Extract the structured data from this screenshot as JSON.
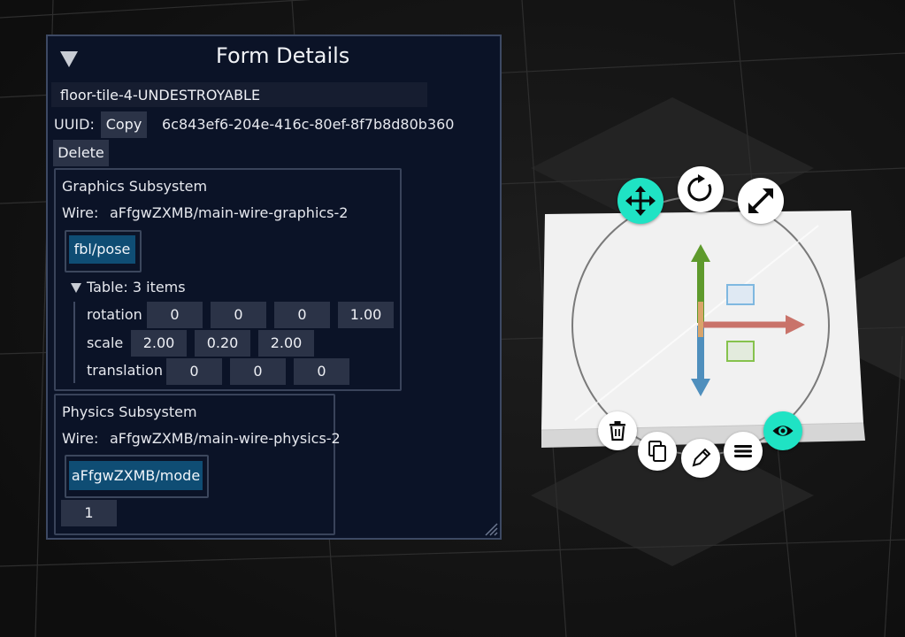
{
  "panel": {
    "title": "Form Details",
    "name_value": "floor-tile-4-UNDESTROYABLE",
    "uuid_label": "UUID:",
    "copy_label": "Copy",
    "uuid_value": "6c843ef6-204e-416c-80ef-8f7b8d80b360",
    "delete_label": "Delete"
  },
  "graphics": {
    "title": "Graphics Subsystem",
    "wire_label": "Wire:",
    "wire_value": "aFfgwZXMB/main-wire-graphics-2",
    "chip": "fbl/pose",
    "table_label": "Table: 3 items",
    "rows": [
      {
        "label": "rotation",
        "values": [
          "0",
          "0",
          "0",
          "1.00"
        ]
      },
      {
        "label": "scale",
        "values": [
          "2.00",
          "0.20",
          "2.00"
        ]
      },
      {
        "label": "translation",
        "values": [
          "0",
          "0",
          "0"
        ]
      }
    ]
  },
  "physics": {
    "title": "Physics Subsystem",
    "wire_label": "Wire:",
    "wire_value": "aFfgwZXMB/main-wire-physics-2",
    "chip": "aFfgwZXMB/mode",
    "mode_value": "1"
  },
  "gizmo": {
    "active_color": "#1fe3c4",
    "axis_colors": {
      "x": "#c9736a",
      "y": "#5e9a2c",
      "z": "#4f8fbd"
    },
    "buttons": [
      "move-icon",
      "rotate-icon",
      "scale-icon",
      "delete-icon",
      "duplicate-icon",
      "edit-icon",
      "menu-icon",
      "visibility-icon"
    ]
  }
}
